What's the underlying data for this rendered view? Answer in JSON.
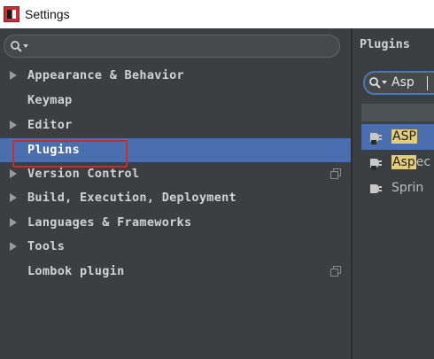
{
  "window": {
    "title": "Settings"
  },
  "sidebar": {
    "search": {
      "placeholder": ""
    },
    "items": [
      {
        "label": "Appearance & Behavior",
        "expandable": true,
        "selected": false,
        "has_project_icon": false
      },
      {
        "label": "Keymap",
        "expandable": false,
        "selected": false,
        "has_project_icon": false
      },
      {
        "label": "Editor",
        "expandable": true,
        "selected": false,
        "has_project_icon": false
      },
      {
        "label": "Plugins",
        "expandable": false,
        "selected": true,
        "has_project_icon": false
      },
      {
        "label": "Version Control",
        "expandable": true,
        "selected": false,
        "has_project_icon": true
      },
      {
        "label": "Build, Execution, Deployment",
        "expandable": true,
        "selected": false,
        "has_project_icon": false
      },
      {
        "label": "Languages & Frameworks",
        "expandable": true,
        "selected": false,
        "has_project_icon": false
      },
      {
        "label": "Tools",
        "expandable": true,
        "selected": false,
        "has_project_icon": false
      },
      {
        "label": "Lombok plugin",
        "expandable": false,
        "selected": false,
        "has_project_icon": true
      }
    ]
  },
  "plugins_panel": {
    "title": "Plugins",
    "search": {
      "value": "Asp"
    },
    "list": [
      {
        "match": "ASP",
        "rest": "",
        "selected": true
      },
      {
        "match": "Asp",
        "rest": "ec",
        "selected": false
      },
      {
        "match": "",
        "rest": "Sprin",
        "selected": false
      }
    ]
  },
  "colors": {
    "background": "#3c3f41",
    "selection": "#4b6eaf",
    "highlight_box": "#c32f2f",
    "match_highlight": "#e3cf7a",
    "text": "#d2d2d2"
  }
}
